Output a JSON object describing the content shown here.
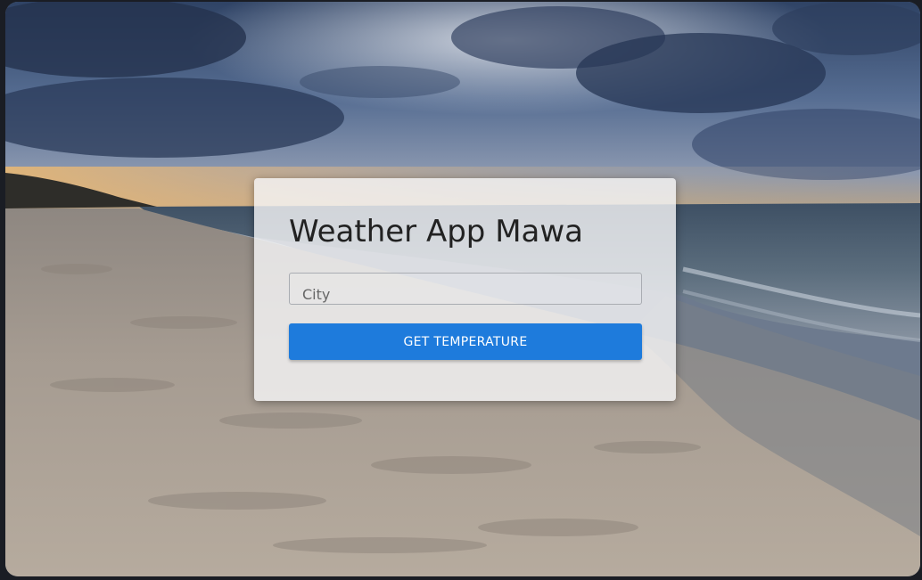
{
  "app": {
    "title": "Weather App Mawa"
  },
  "form": {
    "city_placeholder": "City",
    "city_value": "",
    "submit_label": "GET TEMPERATURE"
  },
  "colors": {
    "button": "#1e7bdc",
    "card": "#f6f6f8"
  }
}
